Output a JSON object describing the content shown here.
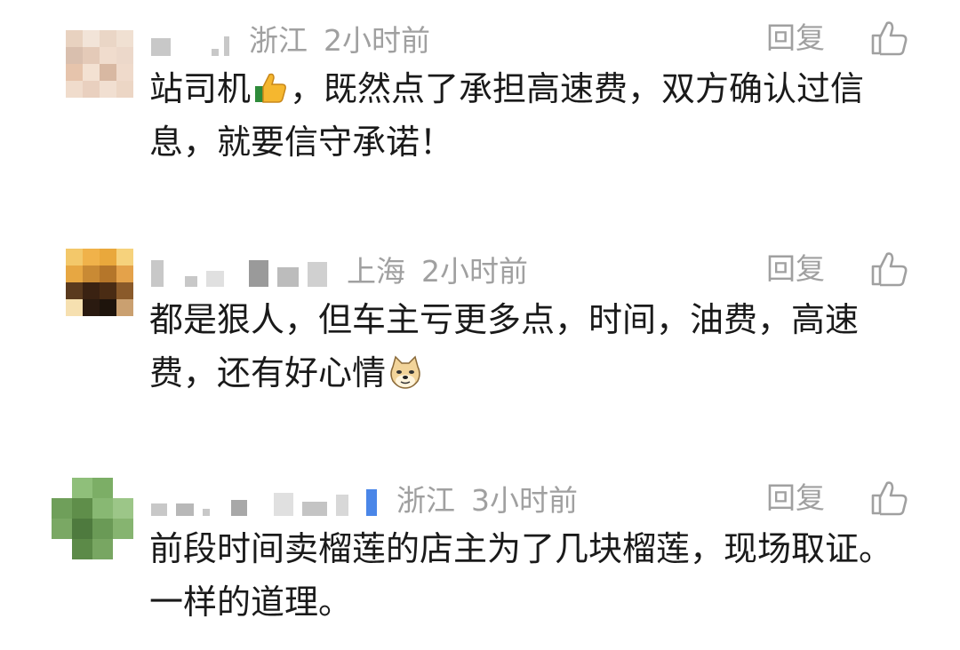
{
  "comments": [
    {
      "location": "浙江",
      "time": "2小时前",
      "reply_label": "回复",
      "text_a": "站司机",
      "text_b": "，既然点了承担高速费，双方确认过信息，就要信守承诺！",
      "emoji_icon": "thumbs-up-emoji",
      "avatar_colors": [
        "#e8d2c0",
        "#f2e4d8",
        "#ead6c6",
        "#f0e0d2",
        "#d9bfae",
        "#e4cab8",
        "#f0dccd",
        "#ecd8ca",
        "#e6c4ac",
        "#f3e1d2",
        "#d8b8a2",
        "#efdacb",
        "#f0dccc",
        "#e9d0bf",
        "#f1dfd1",
        "#ecd6c5"
      ]
    },
    {
      "location": "上海",
      "time": "2小时前",
      "reply_label": "回复",
      "text_a": "都是狠人，但车主亏更多点，时间，油费，高速费，还有好心情",
      "text_b": "",
      "emoji_icon": "doge-emoji",
      "avatar_colors": [
        "#f3c86a",
        "#f0b24a",
        "#e9a83c",
        "#f6d27c",
        "#e7a742",
        "#c98a34",
        "#b5762a",
        "#e4a24a",
        "#5a3a1e",
        "#3a2212",
        "#4a2c14",
        "#8a5a2a",
        "#f6e0b0",
        "#2a1a10",
        "#1e140c",
        "#caa070"
      ]
    },
    {
      "location": "浙江",
      "time": "3小时前",
      "reply_label": "回复",
      "text_a": "前段时间卖榴莲的店主为了几块榴莲，现场取证。一样的道理。",
      "text_b": "",
      "emoji_icon": "",
      "avatar_colors": [
        "#ffffff",
        "#8fbf7a",
        "#7cae66",
        "#ffffff",
        "#6f9f5a",
        "#5f8e4a",
        "#88b873",
        "#9cc688",
        "#7aa864",
        "#4e7a3e",
        "#6a9a56",
        "#86b470",
        "#ffffff",
        "#5c8a48",
        "#78a662",
        "#ffffff"
      ]
    }
  ]
}
